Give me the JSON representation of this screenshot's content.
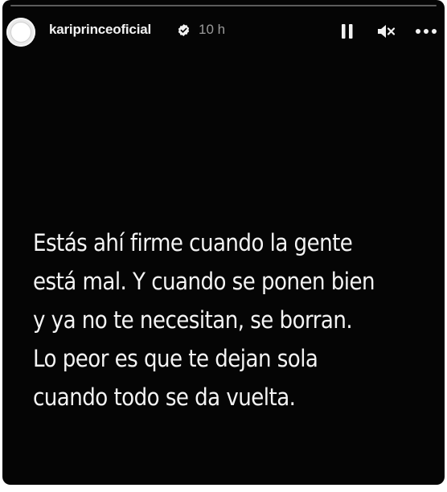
{
  "story": {
    "progress_fraction": 0.0,
    "header": {
      "username": "kariprinceoficial",
      "time": "10 h",
      "verified": true
    },
    "controls": {
      "pause_icon": "pause-icon",
      "mute_icon": "speaker-muted-icon",
      "more_icon": "more-horizontal-icon"
    },
    "text_lines": [
      "Estás ahí firme cuando la gente",
      "está mal. Y cuando se ponen bien",
      "y ya no te necesitan, se borran.",
      "Lo peor es que te dejan sola",
      "cuando todo se da vuelta."
    ],
    "colors": {
      "background": "#050505",
      "text": "#f4f4f4",
      "time": "#9b9b9b"
    }
  }
}
